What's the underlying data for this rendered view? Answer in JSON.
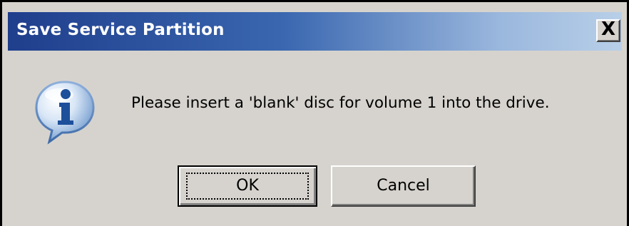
{
  "dialog": {
    "title": "Save Service Partition",
    "close_label": "X",
    "icon": "information-icon",
    "message": "Please insert a 'blank' disc for volume 1 into the drive.",
    "buttons": {
      "ok_label": "OK",
      "cancel_label": "Cancel"
    }
  },
  "colors": {
    "titlebar_start": "#1f3e8c",
    "titlebar_end": "#b8cfe8",
    "dialog_bg": "#d6d3ce"
  }
}
